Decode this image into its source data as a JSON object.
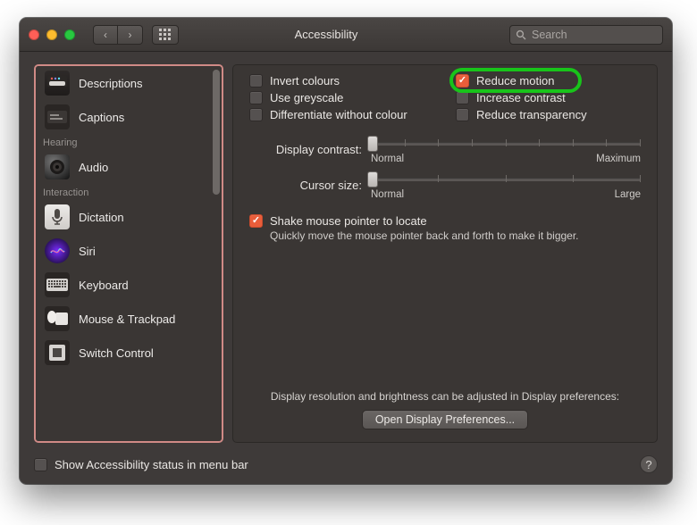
{
  "window": {
    "title": "Accessibility"
  },
  "toolbar": {
    "search_placeholder": "Search"
  },
  "sidebar": {
    "items": [
      {
        "label": "Descriptions"
      },
      {
        "label": "Captions"
      }
    ],
    "hearing_header": "Hearing",
    "hearing_items": [
      {
        "label": "Audio"
      }
    ],
    "interaction_header": "Interaction",
    "interaction_items": [
      {
        "label": "Dictation"
      },
      {
        "label": "Siri"
      },
      {
        "label": "Keyboard"
      },
      {
        "label": "Mouse & Trackpad"
      },
      {
        "label": "Switch Control"
      }
    ]
  },
  "options": {
    "invert_colours": "Invert colours",
    "use_greyscale": "Use greyscale",
    "differentiate": "Differentiate without colour",
    "reduce_motion": "Reduce motion",
    "increase_contrast": "Increase contrast",
    "reduce_transparency": "Reduce transparency"
  },
  "sliders": {
    "display_contrast": {
      "label": "Display contrast:",
      "min_label": "Normal",
      "max_label": "Maximum"
    },
    "cursor_size": {
      "label": "Cursor size:",
      "min_label": "Normal",
      "max_label": "Large"
    }
  },
  "shake": {
    "label": "Shake mouse pointer to locate",
    "hint": "Quickly move the mouse pointer back and forth to make it bigger."
  },
  "note": "Display resolution and brightness can be adjusted in Display preferences:",
  "open_button": "Open Display Preferences...",
  "menubar_checkbox": "Show Accessibility status in menu bar"
}
